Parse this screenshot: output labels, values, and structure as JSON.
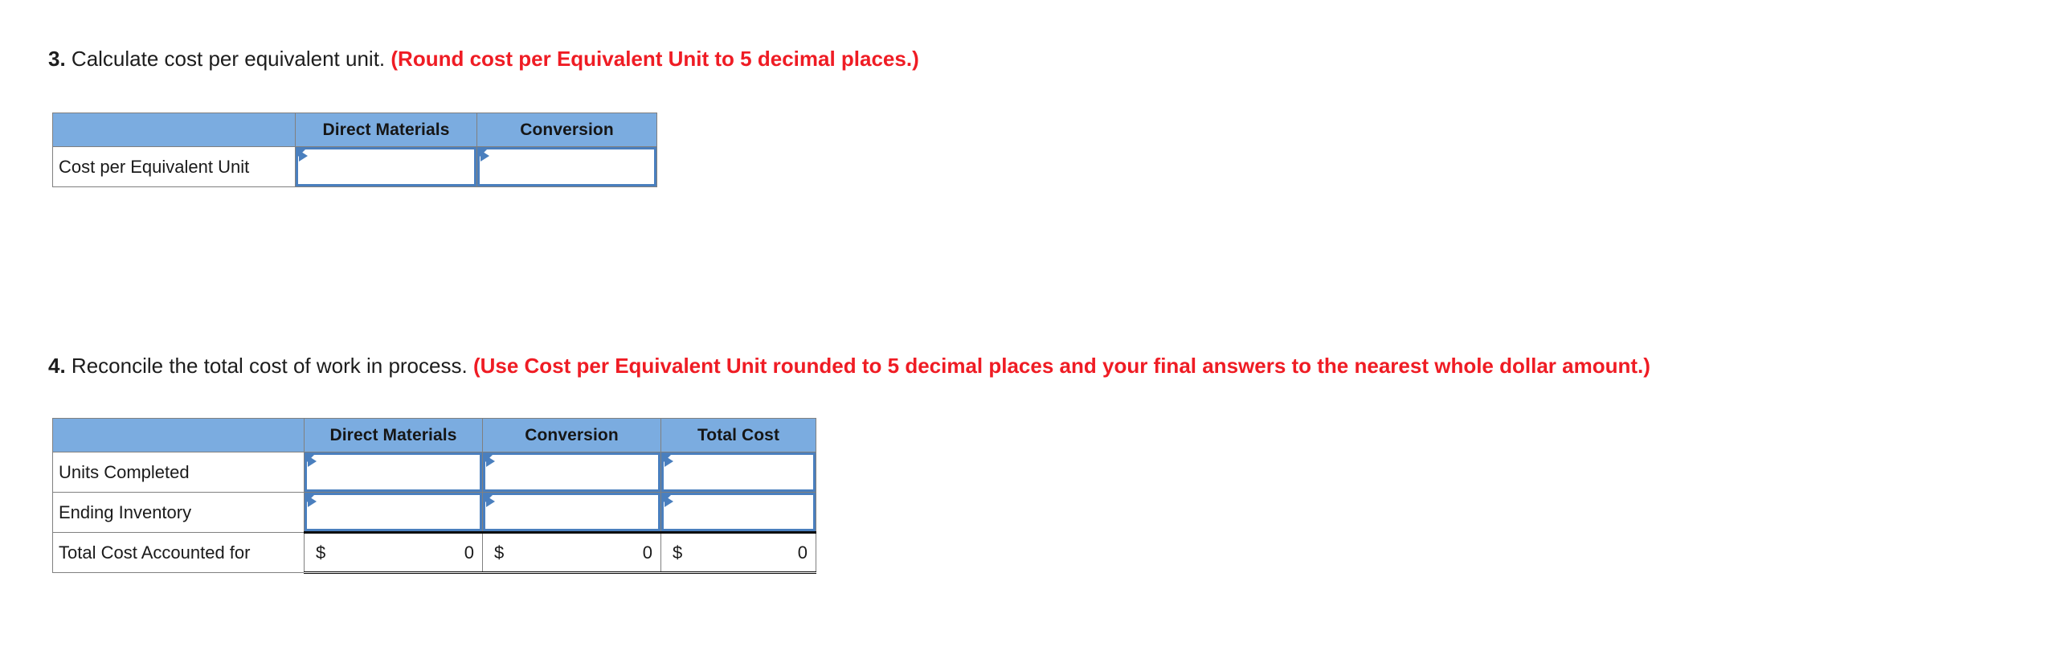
{
  "questions": [
    {
      "number": "3.",
      "text": "Calculate cost per equivalent unit.",
      "note": "(Round cost per Equivalent Unit to 5 decimal places.)"
    },
    {
      "number": "4.",
      "text": "Reconcile the total cost of work in process.",
      "note": "(Use Cost per Equivalent Unit rounded to 5 decimal places and your final answers to the nearest whole dollar amount.)"
    }
  ],
  "colors": {
    "header_blue": "#7bace0",
    "input_border_blue": "#4a7fbe",
    "note_red": "#ef1c24",
    "grid_gray": "#808080",
    "total_rule_black": "#0b0b0b"
  },
  "table_cost_per_unit": {
    "columns": [
      "",
      "Direct Materials",
      "Conversion"
    ],
    "rows": [
      {
        "label": "Cost per Equivalent Unit",
        "cells": [
          {
            "type": "input",
            "value": "",
            "placeholder": ""
          },
          {
            "type": "input",
            "value": "",
            "placeholder": ""
          }
        ]
      }
    ]
  },
  "table_reconcile": {
    "columns": [
      "",
      "Direct Materials",
      "Conversion",
      "Total Cost"
    ],
    "rows": [
      {
        "label": "Units Completed",
        "cells": [
          {
            "type": "input",
            "value": "",
            "placeholder": ""
          },
          {
            "type": "input",
            "value": "",
            "placeholder": ""
          },
          {
            "type": "input",
            "value": "",
            "placeholder": ""
          }
        ]
      },
      {
        "label": "Ending Inventory",
        "cells": [
          {
            "type": "input",
            "value": "",
            "placeholder": ""
          },
          {
            "type": "input",
            "value": "",
            "placeholder": ""
          },
          {
            "type": "input",
            "value": "",
            "placeholder": ""
          }
        ]
      },
      {
        "label": "Total Cost Accounted for",
        "cells": [
          {
            "type": "total",
            "currency": "$",
            "value": "0"
          },
          {
            "type": "total",
            "currency": "$",
            "value": "0"
          },
          {
            "type": "total",
            "currency": "$",
            "value": "0"
          }
        ]
      }
    ]
  }
}
